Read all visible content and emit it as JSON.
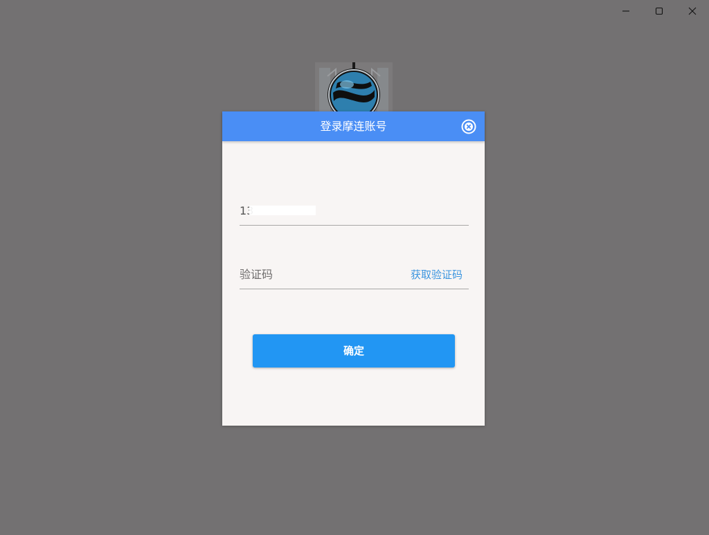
{
  "window": {
    "controls": {
      "minimize_icon": "minimize-icon",
      "maximize_icon": "maximize-icon",
      "close_icon": "close-icon"
    },
    "background_color": "#737172"
  },
  "dialog": {
    "title": "登录摩连账号",
    "header_color": "#4a8ef5",
    "close_icon": "close-circle-icon",
    "phone_field": {
      "value": "13"
    },
    "code_field": {
      "placeholder": "验证码",
      "value": ""
    },
    "get_code_label": "获取验证码",
    "confirm_label": "确定",
    "accent_color": "#2296f3",
    "link_color": "#3b95df"
  },
  "logo": {
    "icon": "app-logo-globe-icon"
  }
}
